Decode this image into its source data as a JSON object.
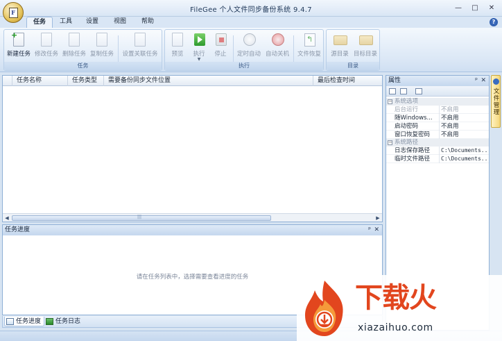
{
  "window": {
    "title": "FileGee 个人文件同步备份系统 9.4.7",
    "app_logo_letter": "F",
    "controls": {
      "minimize": "—",
      "maximize": "□",
      "close": "✕"
    },
    "help": "?"
  },
  "ribbon": {
    "tabs": [
      {
        "label": "任务",
        "active": true
      },
      {
        "label": "工具",
        "active": false
      },
      {
        "label": "设置",
        "active": false
      },
      {
        "label": "视图",
        "active": false
      },
      {
        "label": "帮助",
        "active": false
      }
    ],
    "groups": {
      "task": {
        "label": "任务",
        "buttons": {
          "new_task": "新建任务",
          "edit_task": "修改任务",
          "delete_task": "删除任务",
          "copy_task": "复制任务",
          "link_task": "设置关联任务"
        }
      },
      "execute": {
        "label": "执行",
        "buttons": {
          "preview": "预览",
          "run": "执行",
          "stop": "停止",
          "timed_auto": "定时自动",
          "auto_shutdown": "自动关机",
          "file_restore": "文件恢复"
        }
      },
      "directory": {
        "label": "目录",
        "buttons": {
          "source_dir": "源目录",
          "target_dir": "目标目录"
        }
      }
    }
  },
  "task_list": {
    "columns": [
      "任务名称",
      "任务类型",
      "需要备份同步文件位置",
      "最后检查时间"
    ],
    "rows": [],
    "scroll_left": "◀",
    "scroll_right": "▶",
    "scroll_grip": "|||"
  },
  "properties": {
    "title": "属性",
    "pin": "ᵖ",
    "close": "✕",
    "categories": [
      {
        "name": "系统选项",
        "toggle": "−",
        "rows": [
          {
            "name": "后台运行",
            "value": "不启用",
            "disabled": true
          },
          {
            "name": "随Windows...",
            "value": "不启用",
            "disabled": false
          },
          {
            "name": "启动密码",
            "value": "不启用",
            "disabled": false
          },
          {
            "name": "窗口恢复密码",
            "value": "不启用",
            "disabled": false
          }
        ]
      },
      {
        "name": "系统路径",
        "toggle": "−",
        "rows": [
          {
            "name": "日志保存路径",
            "value": "C:\\Documents...",
            "disabled": false
          },
          {
            "name": "临时文件路径",
            "value": "C:\\Documents...",
            "disabled": false
          }
        ]
      }
    ]
  },
  "side_tab": {
    "label": "文件管理"
  },
  "progress_panel": {
    "title": "任务进度",
    "pin": "ᵖ",
    "close": "✕",
    "hint": "请在任务列表中，选择需要查看进度的任务"
  },
  "bottom_tabs": [
    {
      "label": "任务进度",
      "active": true
    },
    {
      "label": "任务日志",
      "active": false
    }
  ],
  "watermark": {
    "title": "下载火",
    "url": "xiazaihuo.com"
  },
  "colors": {
    "accent": "#e2461e",
    "ribbon_bg": "#dce8f6",
    "panel_border": "#8fb0d6"
  }
}
